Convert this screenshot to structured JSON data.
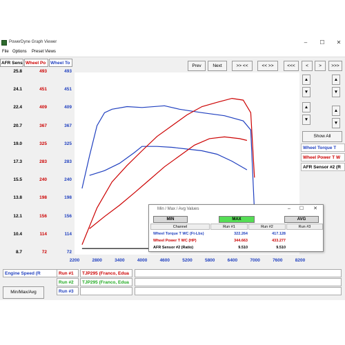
{
  "window": {
    "title": "PowerDyne Graph Viewer",
    "menu": [
      "File",
      "Options",
      "Preset Views"
    ]
  },
  "columns": {
    "afr": {
      "label": "AFR Sens",
      "color": "#000000",
      "ticks": [
        "25.8",
        "24.1",
        "22.4",
        "20.7",
        "19.0",
        "17.3",
        "15.5",
        "13.8",
        "12.1",
        "10.4",
        "8.7"
      ]
    },
    "power": {
      "label": "Wheel Po",
      "color": "#cc0000",
      "ticks": [
        "493",
        "451",
        "409",
        "367",
        "325",
        "283",
        "240",
        "198",
        "156",
        "114",
        "72"
      ]
    },
    "torque": {
      "label": "Wheel To",
      "color": "#1f3fbf",
      "ticks": [
        "493",
        "451",
        "409",
        "367",
        "325",
        "283",
        "240",
        "198",
        "156",
        "114",
        "72"
      ]
    }
  },
  "toolbar": {
    "prev": "Prev",
    "next": "Next",
    "b1": ">> <<",
    "b2": "<< >>",
    "b3": "<<<",
    "b4": "<",
    "b5": ">",
    "b6": ">>>"
  },
  "xaxis": {
    "ticks": [
      "2200",
      "2800",
      "3400",
      "4000",
      "4600",
      "5200",
      "5800",
      "6400",
      "7000",
      "7600",
      "8200"
    ]
  },
  "side": {
    "up": "▲",
    "down": "▼",
    "show_all": "Show All"
  },
  "legend": [
    {
      "label": "Wheel Torque T",
      "color": "#1f3fbf"
    },
    {
      "label": "Wheel Power T W",
      "color": "#cc0000"
    },
    {
      "label": "AFR Sensor #2 (R",
      "color": "#000000"
    }
  ],
  "bottom": {
    "xaxis_label": "Engine Speed (R",
    "minmax_button": "Min/Max/Avg",
    "runs": [
      {
        "label": "Run #1",
        "name": "TJP295 (Franco, Edua",
        "color": "#cc0000"
      },
      {
        "label": "Run #2",
        "name": "TJP295 (Franco, Edua",
        "color": "#22aa22"
      },
      {
        "label": "Run #3",
        "name": "",
        "color": "#1f3fbf"
      }
    ]
  },
  "dialog": {
    "title": "Min / Max / Avg Values",
    "buttons": [
      "MIN",
      "MAX",
      "AVG"
    ],
    "headers": [
      "Channel",
      "Run #1",
      "Run #2",
      "Run #3"
    ],
    "rows": [
      {
        "channel": "Wheel Torque T WC (Ft-Lbs)",
        "run1": "322.264",
        "run2": "417.128",
        "run3": "",
        "color": "#1f3fbf"
      },
      {
        "channel": "Wheel Power T WC (HP)",
        "run1": "344.663",
        "run2": "433.277",
        "run3": "",
        "color": "#cc0000"
      },
      {
        "channel": "AFR Sensor #2 (Ratio)",
        "run1": "9.510",
        "run2": "9.510",
        "run3": "",
        "color": "#000000"
      }
    ]
  },
  "chart_data": {
    "type": "line",
    "xlabel": "Engine Speed (R",
    "xlim": [
      2200,
      8200
    ],
    "ylim": [
      72,
      493
    ],
    "series": [
      {
        "name": "Wheel Torque T",
        "run": 1,
        "color": "#1f3fbf",
        "x": [
          2600,
          3000,
          3400,
          3800,
          4000,
          4400,
          4800,
          5200,
          5600,
          6000,
          6400,
          6800
        ],
        "y": [
          255,
          266,
          283,
          308,
          322,
          322,
          320,
          316,
          312,
          304,
          288,
          268
        ]
      },
      {
        "name": "Wheel Power T W",
        "run": 1,
        "color": "#cc0000",
        "x": [
          2600,
          3000,
          3400,
          3800,
          4200,
          4600,
          5000,
          5400,
          5800,
          6200,
          6600,
          6800
        ],
        "y": [
          132,
          160,
          186,
          215,
          245,
          275,
          300,
          325,
          340,
          344,
          340,
          336
        ]
      },
      {
        "name": "Wheel Torque T",
        "run": 2,
        "color": "#1f3fbf",
        "x": [
          2400,
          2600,
          2800,
          3000,
          3200,
          3600,
          4000,
          4600,
          5000,
          5600,
          6200,
          6700,
          6900,
          7000
        ],
        "y": [
          225,
          300,
          370,
          400,
          408,
          414,
          412,
          416,
          408,
          400,
          393,
          381,
          360,
          170
        ]
      },
      {
        "name": "Wheel Power T W",
        "run": 2,
        "color": "#cc0000",
        "x": [
          2400,
          2800,
          3200,
          3600,
          4000,
          4400,
          4800,
          5200,
          5600,
          6000,
          6400,
          6700,
          6900,
          7000
        ],
        "y": [
          95,
          180,
          240,
          278,
          312,
          345,
          370,
          395,
          414,
          424,
          433,
          429,
          400,
          250
        ]
      },
      {
        "name": "AFR Sensor #2 (R",
        "run": 1,
        "color": "#000000",
        "x": [
          2400,
          4600
        ],
        "y": [
          86,
          86
        ]
      }
    ]
  }
}
